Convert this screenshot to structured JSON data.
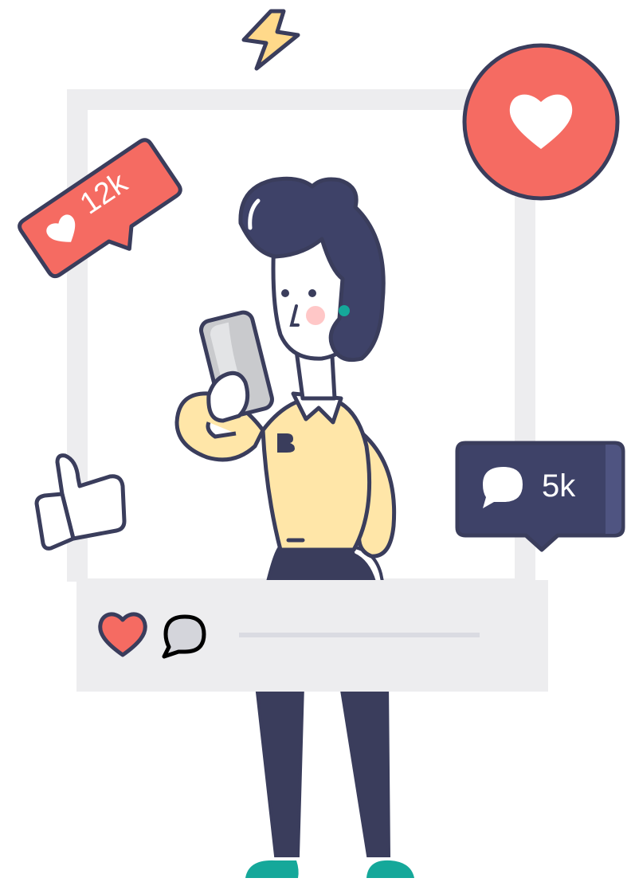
{
  "badges": {
    "likes": {
      "count": "12k",
      "color": "#F56B62"
    },
    "comments": {
      "count": "5k",
      "color": "#3E4268"
    }
  },
  "post_actions": {
    "like_icon": "heart-icon",
    "comment_icon": "speech-bubble-icon"
  },
  "floating_icons": [
    "lightning-icon",
    "heart-icon",
    "thumbs-up-icon"
  ],
  "colors": {
    "outline": "#3A3D5C",
    "coral": "#F56B62",
    "navy": "#3E4268",
    "frame": "#EDEDEF",
    "shirt": "#FFE6A8",
    "skin": "#FFFFFF",
    "teal": "#15A89A",
    "phone": "#C9CACD",
    "yellow": "#FFD98A"
  }
}
